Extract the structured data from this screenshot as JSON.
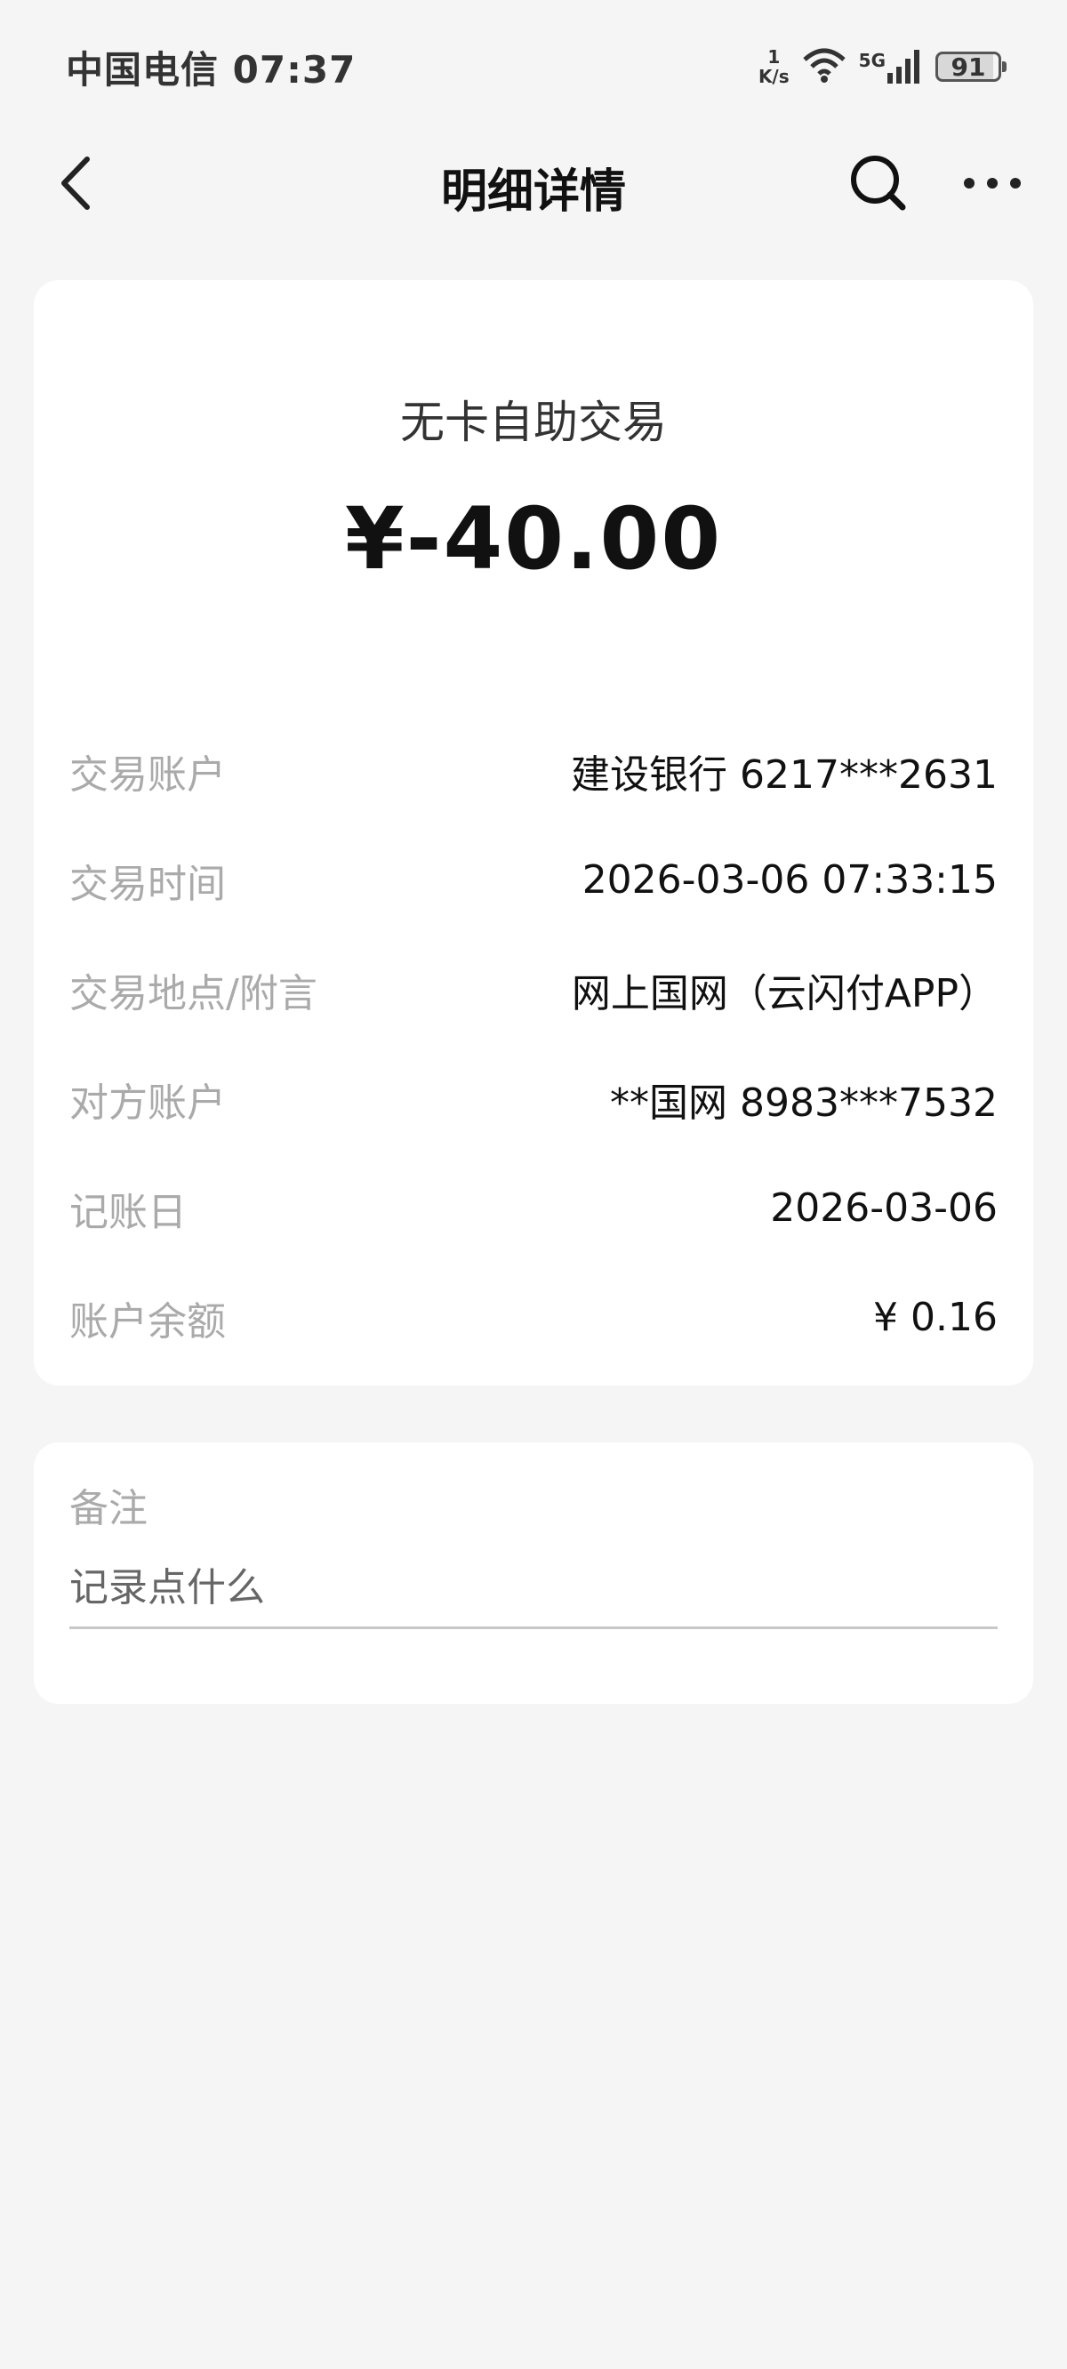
{
  "status_bar": {
    "carrier_time": "中国电信 07:37",
    "net_speed_value": "1",
    "net_speed_unit": "K/s",
    "signal_label": "5G",
    "battery": "91"
  },
  "nav": {
    "title": "明细详情",
    "icons": [
      "back-icon",
      "search-icon",
      "more-icon"
    ]
  },
  "transaction": {
    "type": "无卡自助交易",
    "amount": "¥-40.00",
    "rows": [
      {
        "label": "交易账户",
        "value": "建设银行 6217***2631"
      },
      {
        "label": "交易时间",
        "value": "2026-03-06 07:33:15"
      },
      {
        "label": "交易地点/附言",
        "value": "网上国网（云闪付APP）"
      },
      {
        "label": "对方账户",
        "value": "**国网 8983***7532"
      },
      {
        "label": "记账日",
        "value": "2026-03-06"
      },
      {
        "label": "账户余额",
        "value": "¥ 0.16"
      }
    ]
  },
  "note": {
    "label": "备注",
    "placeholder": "记录点什么"
  }
}
